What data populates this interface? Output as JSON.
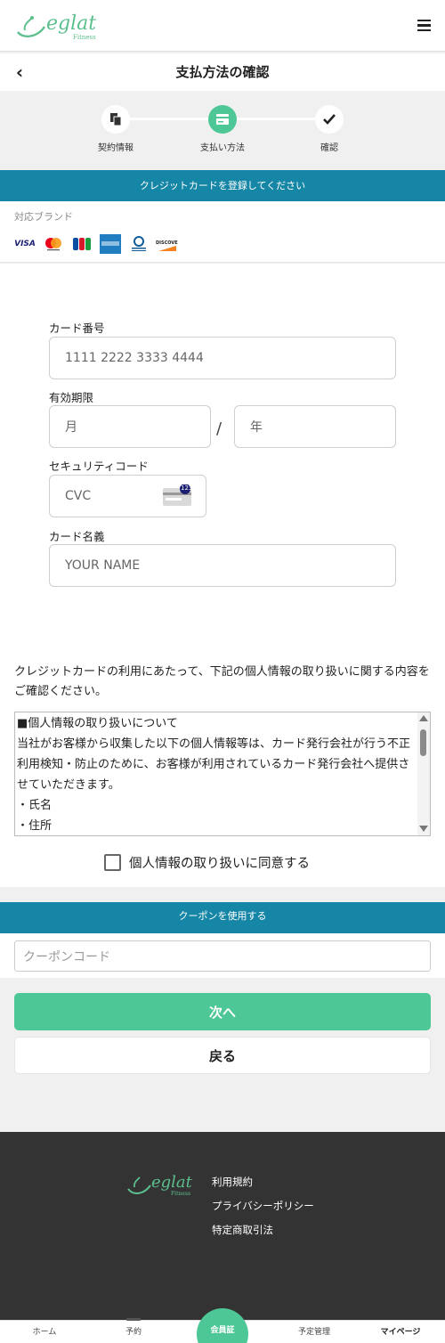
{
  "header": {
    "logo_text": "eglat",
    "logo_sub": "Fitness",
    "menu_icon": "hamburger-menu-icon"
  },
  "titlebar": {
    "back_icon": "chevron-left-icon",
    "back_glyph": "‹",
    "title": "支払方法の確認"
  },
  "steps": [
    {
      "label": "契約情報",
      "icon": "document-icon",
      "active": false
    },
    {
      "label": "支払い方法",
      "icon": "credit-card-icon",
      "active": true
    },
    {
      "label": "確認",
      "icon": "checkmark-icon",
      "active": false
    }
  ],
  "card_section": {
    "banner": "クレジットカードを登録してください",
    "brands_label": "対応ブランド",
    "brands": [
      "VISA",
      "Mastercard",
      "JCB",
      "American Express",
      "Diners Club",
      "DISCOVER"
    ]
  },
  "form": {
    "card_number_label": "カード番号",
    "card_number_placeholder": "1111 2222 3333 4444",
    "expiry_label": "有効期限",
    "month_placeholder": "月",
    "separator": "/",
    "year_placeholder": "年",
    "cvc_label": "セキュリティコード",
    "cvc_placeholder": "CVC",
    "cvc_badge": "123",
    "name_label": "カード名義",
    "name_placeholder": "YOUR NAME"
  },
  "privacy": {
    "notice": "クレジットカードの利用にあたって、下記の個人情報の取り扱いに関する内容をご確認ください。",
    "lines": [
      "■個人情報の取り扱いについて",
      "当社がお客様から収集した以下の個人情報等は、カード発行会社が行う不正利用検知・防止のために、お客様が利用されているカード発行会社へ提供させていただきます。",
      "・氏名",
      "・住所"
    ],
    "agree_label": "個人情報の取り扱いに同意する",
    "agreed": false
  },
  "coupon": {
    "banner": "クーポンを使用する",
    "placeholder": "クーポンコード"
  },
  "actions": {
    "next_label": "次へ",
    "back_label": "戻る"
  },
  "footer": {
    "logo_text": "eglat",
    "logo_sub": "Fitness",
    "links": [
      "利用規約",
      "プライバシーポリシー",
      "特定商取引法"
    ]
  },
  "bottom_nav": {
    "items": [
      "ホーム",
      "予約",
      "会員証",
      "予定管理",
      "マイページ"
    ],
    "selected": "マイページ"
  },
  "colors": {
    "accent_green": "#4ec796",
    "banner_blue": "#1686a6",
    "footer_dark": "#333333"
  }
}
